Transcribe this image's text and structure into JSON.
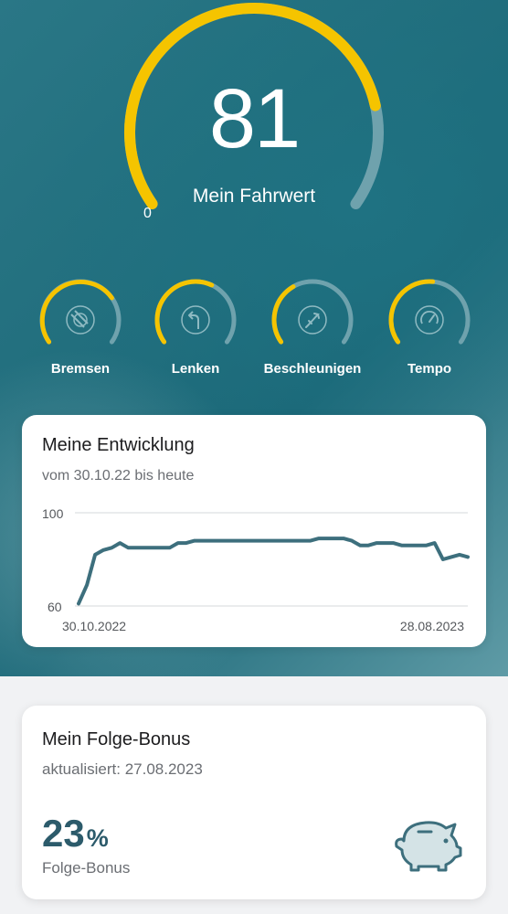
{
  "header": {
    "score": "81",
    "score_label": "Mein Fahrwert",
    "scale_min": "0",
    "score_fraction": 0.81
  },
  "categories": [
    {
      "label": "Bremsen",
      "icon": "brake-icon",
      "fraction": 0.72
    },
    {
      "label": "Lenken",
      "icon": "steering-arrow-icon",
      "fraction": 0.6
    },
    {
      "label": "Beschleunigen",
      "icon": "rocket-icon",
      "fraction": 0.38
    },
    {
      "label": "Tempo",
      "icon": "speedometer-icon",
      "fraction": 0.52
    }
  ],
  "development": {
    "title": "Meine Entwicklung",
    "subtitle": "vom 30.10.22 bis heute"
  },
  "chart_data": {
    "type": "line",
    "title": "Meine Entwicklung",
    "ylim": [
      60,
      100
    ],
    "yticks": [
      "100",
      "60"
    ],
    "x_start_label": "30.10.2022",
    "x_end_label": "28.08.2023",
    "series": [
      {
        "values": [
          61,
          69,
          82,
          84,
          85,
          87,
          85,
          85,
          85,
          85,
          85,
          85,
          87,
          87,
          88,
          88,
          88,
          88,
          88,
          88,
          88,
          88,
          88,
          88,
          88,
          88,
          88,
          88,
          88,
          89,
          89,
          89,
          89,
          88,
          86,
          86,
          87,
          87,
          87,
          86,
          86,
          86,
          86,
          87,
          80,
          81,
          82,
          81
        ]
      }
    ]
  },
  "bonus": {
    "title": "Mein Folge-Bonus",
    "updated": "aktualisiert: 27.08.2023",
    "value": "23",
    "unit": "%",
    "label": "Folge-Bonus",
    "icon": "piggy-bank-icon"
  },
  "colors": {
    "accent_yellow": "#f5c400",
    "track": "#6fa2ad",
    "line": "#3d6f7d",
    "bonus_text": "#2c5b6b"
  }
}
